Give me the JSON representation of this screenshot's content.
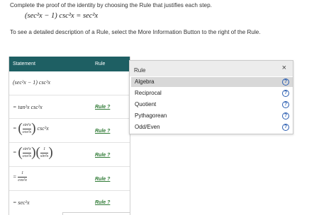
{
  "instructions": {
    "line1": "Complete the proof of the identity by choosing the Rule that justifies each step.",
    "line2": "To see a detailed description of a Rule, select the More Information Button to the right of the Rule."
  },
  "identity": "(sec²x − 1) csc²x = sec²x",
  "proof": {
    "header": {
      "statement": "Statement",
      "rule": "Rule"
    },
    "rows": [
      {
        "statement": "(sec²x − 1) csc²x",
        "rule": ""
      },
      {
        "statement": "= tan²x csc²x",
        "rule": "Rule ?"
      },
      {
        "statement_num": "sin²x",
        "statement_den": "cos²x",
        "statement_tail": "csc²x",
        "rule": "Rule ?"
      },
      {
        "statement_num": "sin²x",
        "statement_den": "cos²x",
        "statement_num2": "1",
        "statement_den2": "sin²x",
        "rule": "Rule ?"
      },
      {
        "statement_num": "1",
        "statement_den": "cos²x",
        "rule": "Rule ?"
      },
      {
        "statement": "= sec²x",
        "rule": "Rule ?"
      }
    ],
    "eq": "="
  },
  "rule_panel": {
    "title": "Rule",
    "close": "×",
    "items": [
      "Algebra",
      "Reciprocal",
      "Quotient",
      "Pythagorean",
      "Odd/Even"
    ],
    "selected": "Algebra",
    "info_glyph": "?"
  }
}
